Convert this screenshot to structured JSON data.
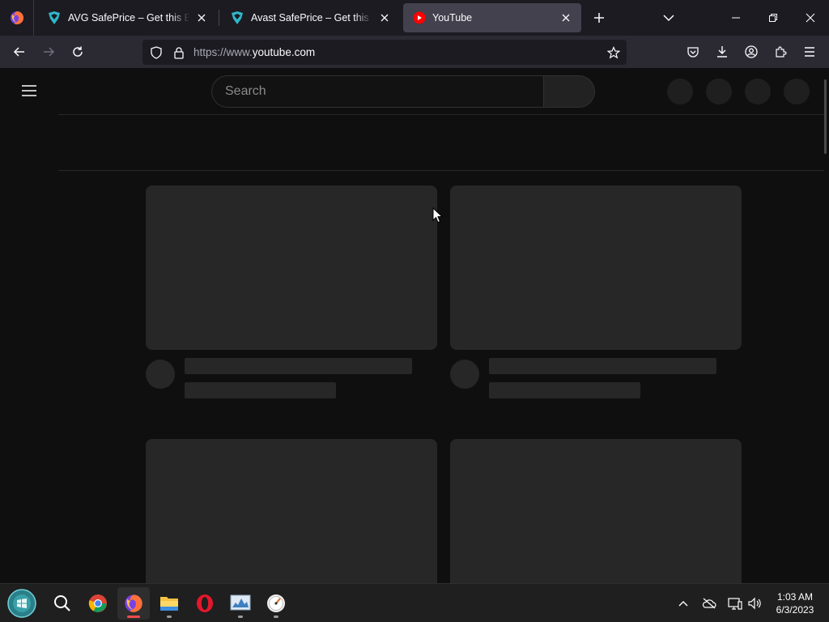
{
  "browser": {
    "tabs": [
      {
        "title": "AVG SafePrice – Get this Extension",
        "icon": "avg-shield-icon",
        "active": false
      },
      {
        "title": "Avast SafePrice – Get this Extension",
        "icon": "avast-shield-icon",
        "active": false
      },
      {
        "title": "YouTube",
        "icon": "youtube-icon",
        "active": true
      }
    ],
    "url": {
      "scheme": "https://www.",
      "host": "youtube.com"
    }
  },
  "youtube": {
    "search_placeholder": "Search"
  },
  "taskbar": {
    "apps": [
      "start-button",
      "search",
      "chrome",
      "firefox",
      "file-explorer",
      "opera",
      "task-manager",
      "clock-app"
    ],
    "time": "1:03 AM",
    "date": "6/3/2023"
  },
  "colors": {
    "tab_strip": "#1c1b22",
    "active_tab": "#42414d",
    "nav_bar": "#2b2a33",
    "page_bg": "#0f0f0f",
    "placeholder": "#272727",
    "youtube_red": "#ff0000"
  }
}
